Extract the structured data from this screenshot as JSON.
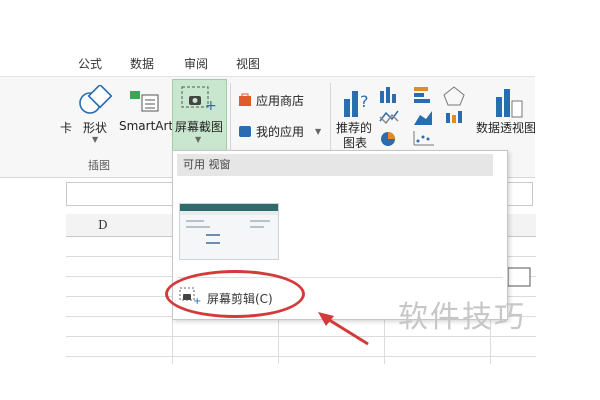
{
  "ribbon_tabs": [
    "公式",
    "数据",
    "审阅",
    "视图"
  ],
  "ribbon": {
    "partial_left": "卡",
    "shapes_label": "形状",
    "smartart_label": "SmartArt",
    "screenshot_label": "屏幕截图",
    "app_store_label": "应用商店",
    "my_apps_label": "我的应用",
    "recommended_charts_label_1": "推荐的",
    "recommended_charts_label_2": "图表",
    "pivot_chart_label": "数据透视图",
    "group_illustrations": "插图"
  },
  "sheet": {
    "column_d": "D"
  },
  "dropdown": {
    "header": "可用 视窗",
    "clip_label": "屏幕剪辑(C)"
  },
  "watermark": "软件技巧",
  "colors": {
    "highlight": "#c9e6cf",
    "annotation_red": "#d33a3a",
    "app_store_orange": "#e05a2b",
    "my_apps_blue": "#2b6cb0"
  }
}
